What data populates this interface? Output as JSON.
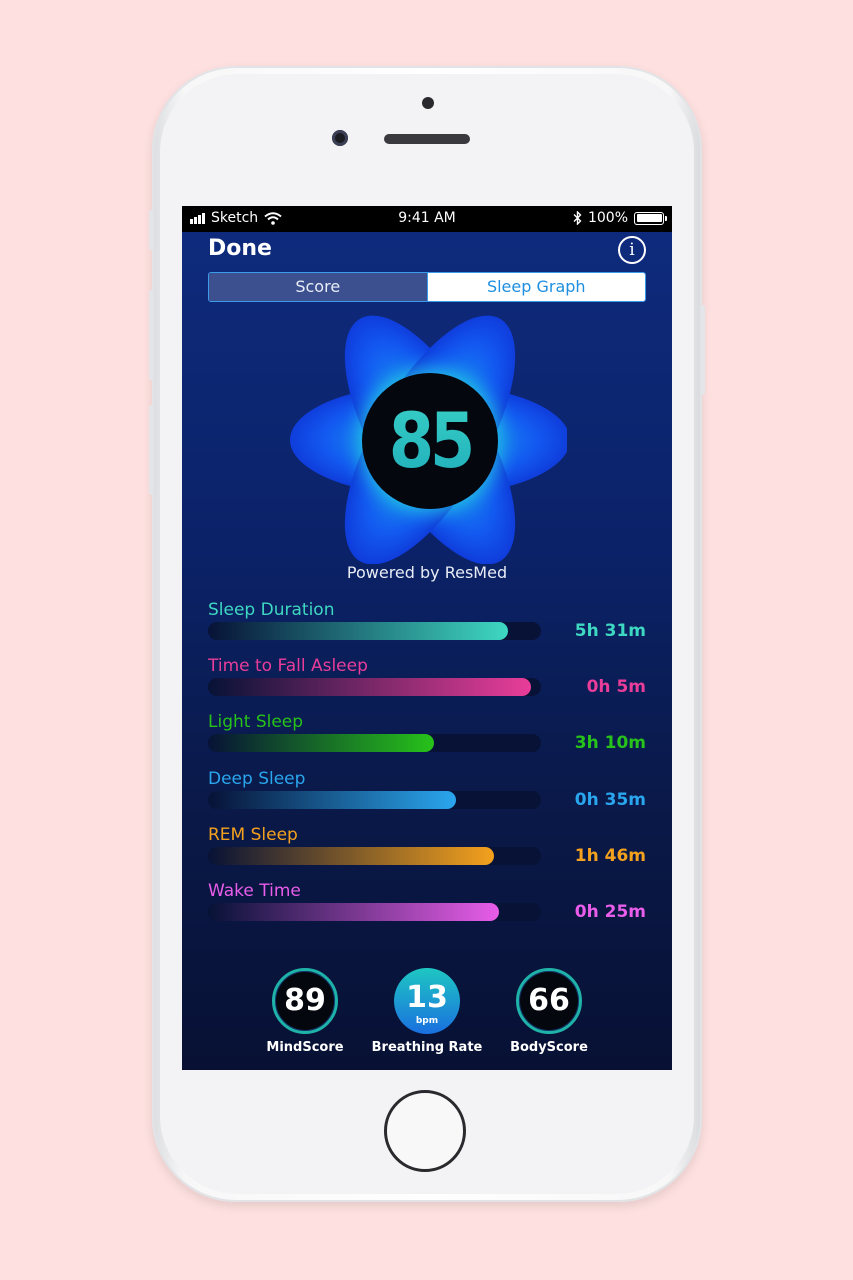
{
  "statusbar": {
    "carrier": "Sketch",
    "time": "9:41 AM",
    "battery": "100%"
  },
  "nav": {
    "done_label": "Done",
    "info_label": "i"
  },
  "tabs": [
    {
      "label": "Score",
      "selected": true
    },
    {
      "label": "Sleep Graph",
      "selected": false
    }
  ],
  "score": {
    "value": "85",
    "powered_by": "Powered by ResMed"
  },
  "metrics": [
    {
      "label": "Sleep Duration",
      "value": "5h 31m",
      "fraction": 0.9,
      "color": "#3ed8c2"
    },
    {
      "label": "Time to Fall Asleep",
      "value": "0h 5m",
      "fraction": 0.97,
      "color": "#e93d99"
    },
    {
      "label": "Light Sleep",
      "value": "3h 10m",
      "fraction": 0.68,
      "color": "#27c21a"
    },
    {
      "label": "Deep Sleep",
      "value": "0h 35m",
      "fraction": 0.745,
      "color": "#2aa6ee"
    },
    {
      "label": "REM Sleep",
      "value": "1h 46m",
      "fraction": 0.86,
      "color": "#f4a11d"
    },
    {
      "label": "Wake Time",
      "value": "0h 25m",
      "fraction": 0.875,
      "color": "#e85de9"
    }
  ],
  "sub_scores": [
    {
      "label": "MindScore",
      "value": "89"
    },
    {
      "label": "Breathing Rate",
      "value": "13",
      "unit": "bpm"
    },
    {
      "label": "BodyScore",
      "value": "66"
    }
  ]
}
